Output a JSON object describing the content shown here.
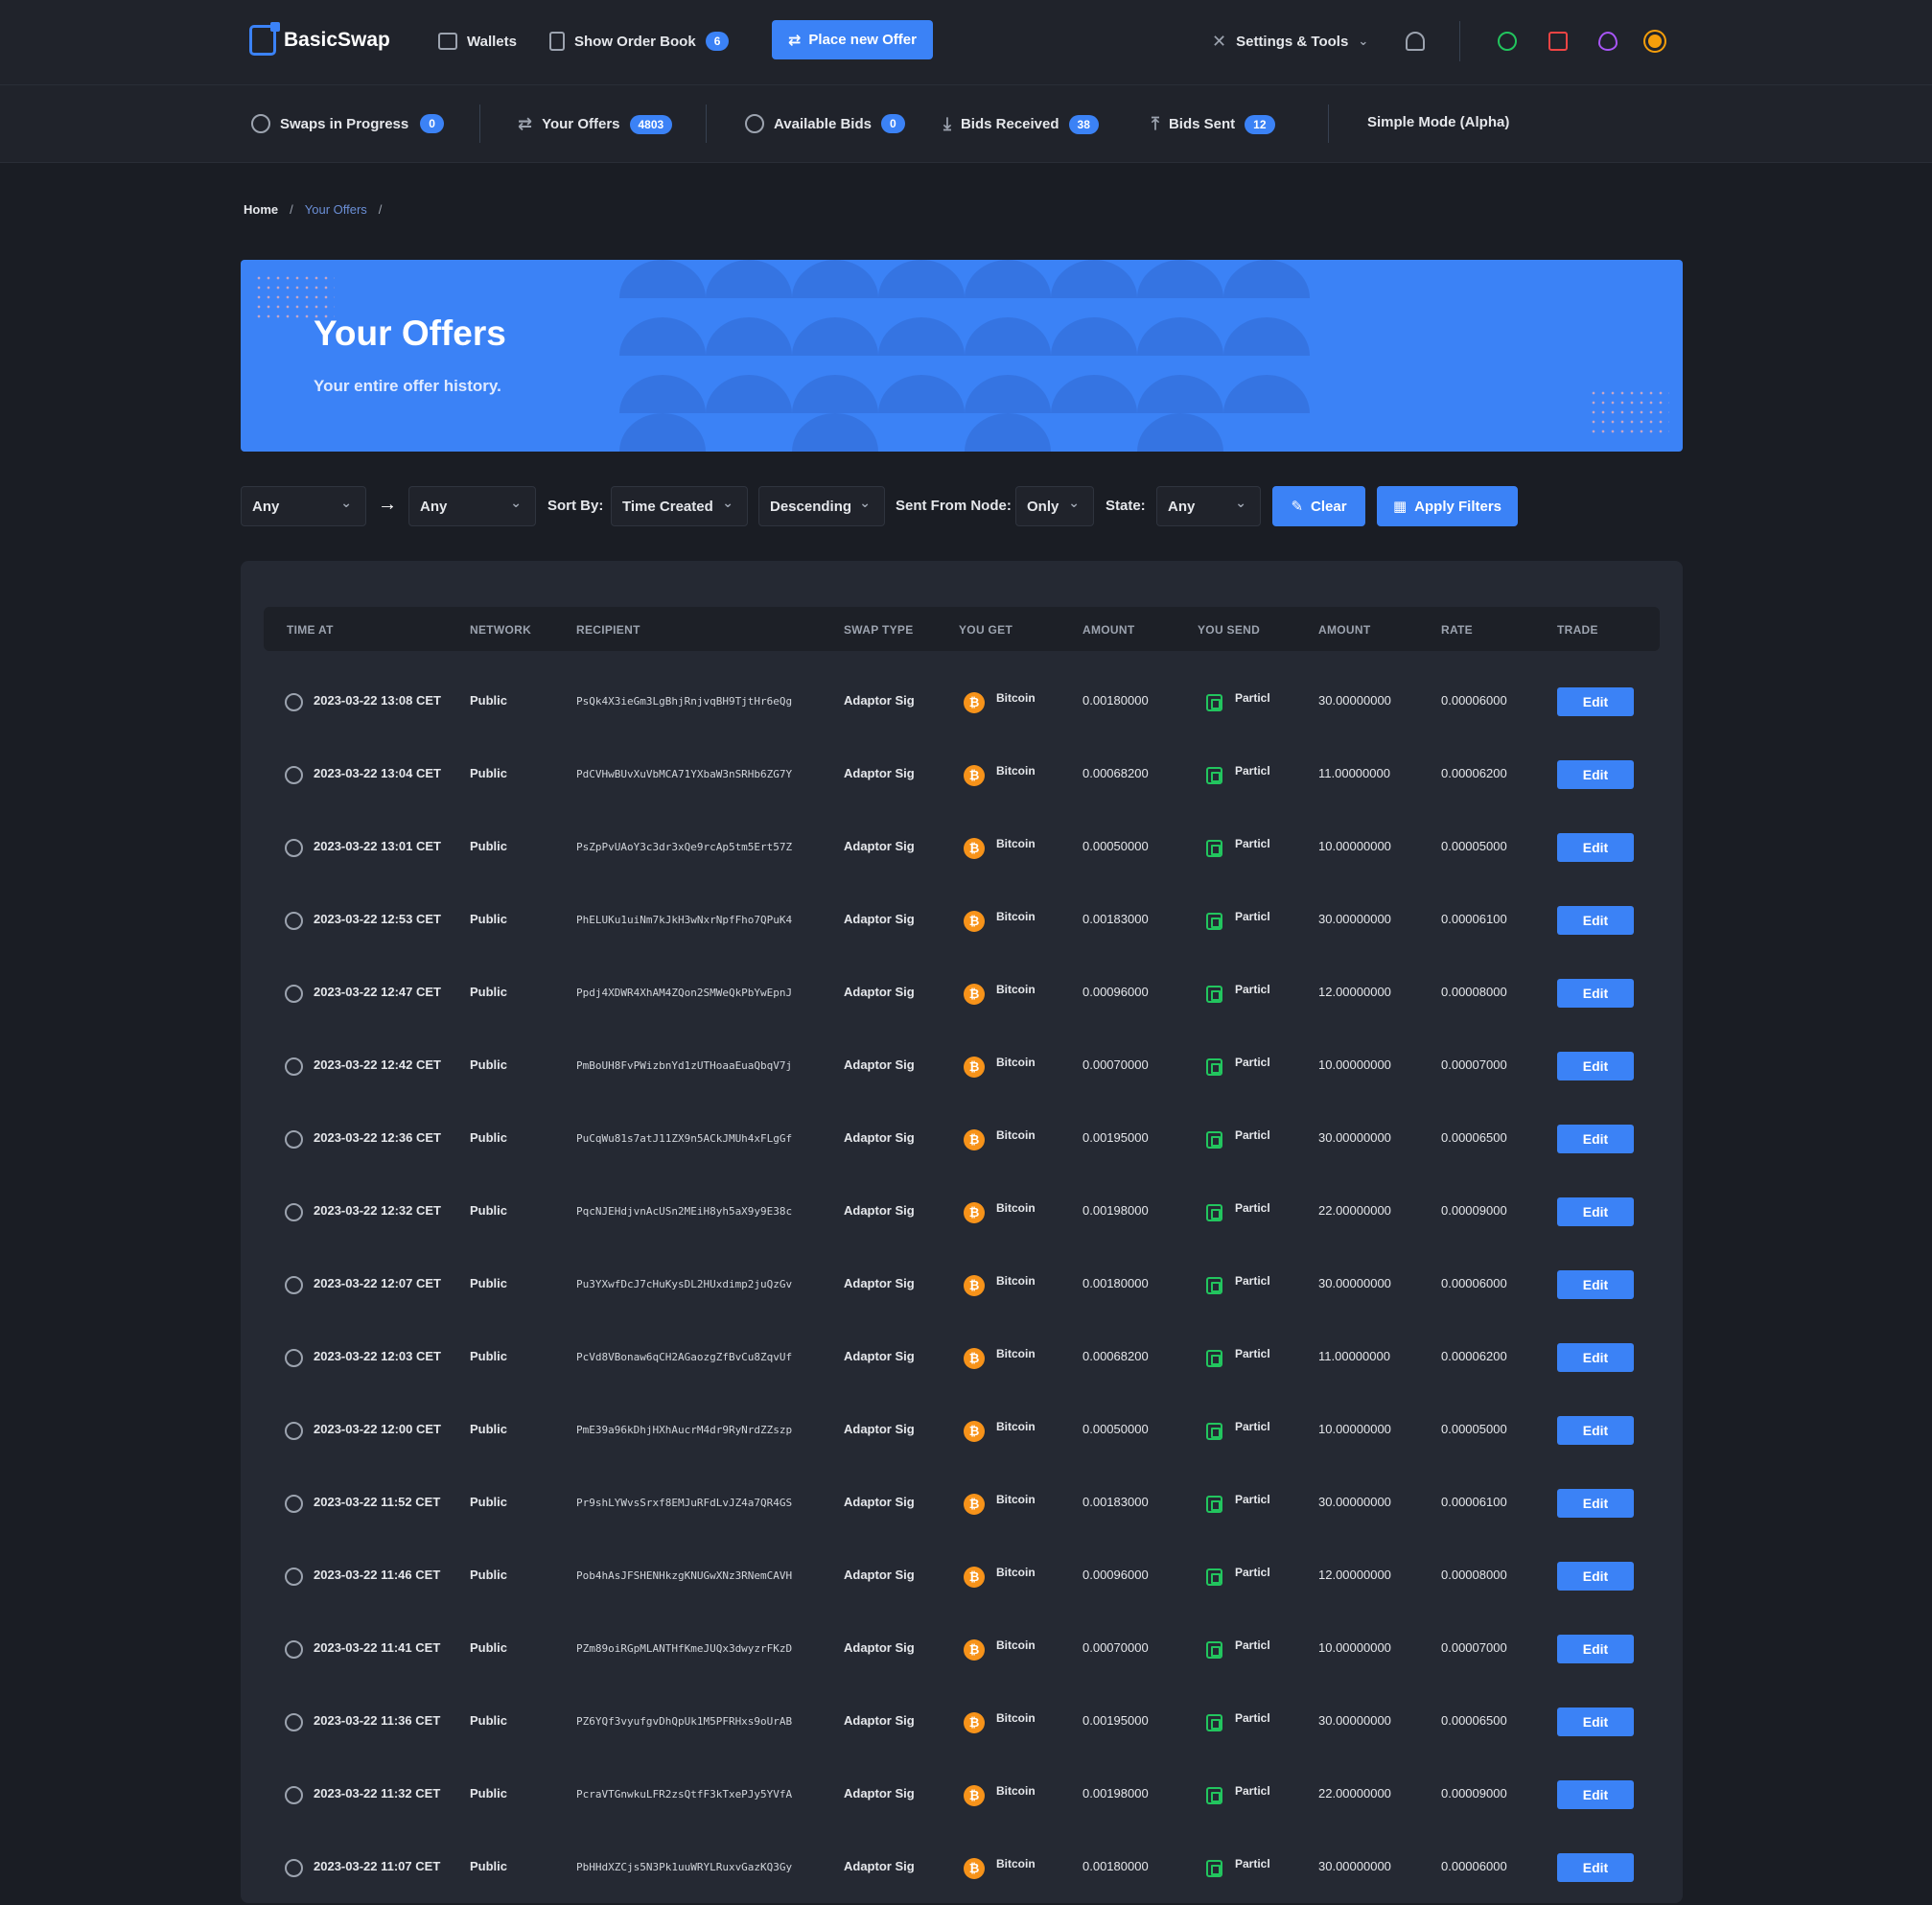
{
  "app": {
    "name": "BasicSwap"
  },
  "topnav": {
    "wallets": "Wallets",
    "order_book": "Show Order Book",
    "order_book_count": "6",
    "place_offer": "Place new Offer",
    "settings": "Settings & Tools"
  },
  "subnav": {
    "swaps": "Swaps in Progress",
    "swaps_count": "0",
    "offers": "Your Offers",
    "offers_count": "4803",
    "available_bids": "Available Bids",
    "available_bids_count": "0",
    "bids_received": "Bids Received",
    "bids_received_count": "38",
    "bids_sent": "Bids Sent",
    "bids_sent_count": "12",
    "simple_mode": "Simple Mode (Alpha)"
  },
  "breadcrumb": {
    "home": "Home",
    "current": "Your Offers",
    "sep": "/"
  },
  "hero": {
    "title": "Your Offers",
    "subtitle": "Your entire offer history."
  },
  "filters": {
    "coin_from": "Any",
    "coin_to": "Any",
    "sort_by_label": "Sort By:",
    "sort_by": "Time Created",
    "order": "Descending",
    "sent_from_label": "Sent From Node:",
    "sent_from": "Only",
    "state_label": "State:",
    "state": "Any",
    "clear": "Clear",
    "apply": "Apply Filters"
  },
  "table": {
    "headers": [
      "TIME AT",
      "NETWORK",
      "RECIPIENT",
      "SWAP TYPE",
      "YOU GET",
      "AMOUNT",
      "YOU SEND",
      "AMOUNT",
      "RATE",
      "TRADE"
    ],
    "edit_label": "Edit",
    "rows": [
      {
        "time": "2023-03-22 13:08 CET",
        "network": "Public",
        "recipient": "PsQk4X3ieGm3LgBhjRnjvqBH9TjtHr6eQg",
        "swap": "Adaptor Sig",
        "get": "Bitcoin",
        "get_amt": "0.00180000",
        "send": "Particl",
        "send_amt": "30.00000000",
        "rate": "0.00006000"
      },
      {
        "time": "2023-03-22 13:04 CET",
        "network": "Public",
        "recipient": "PdCVHwBUvXuVbMCA71YXbaW3nSRHb6ZG7Y",
        "swap": "Adaptor Sig",
        "get": "Bitcoin",
        "get_amt": "0.00068200",
        "send": "Particl",
        "send_amt": "11.00000000",
        "rate": "0.00006200"
      },
      {
        "time": "2023-03-22 13:01 CET",
        "network": "Public",
        "recipient": "PsZpPvUAoY3c3dr3xQe9rcAp5tm5Ert57Z",
        "swap": "Adaptor Sig",
        "get": "Bitcoin",
        "get_amt": "0.00050000",
        "send": "Particl",
        "send_amt": "10.00000000",
        "rate": "0.00005000"
      },
      {
        "time": "2023-03-22 12:53 CET",
        "network": "Public",
        "recipient": "PhELUKu1uiNm7kJkH3wNxrNpfFho7QPuK4",
        "swap": "Adaptor Sig",
        "get": "Bitcoin",
        "get_amt": "0.00183000",
        "send": "Particl",
        "send_amt": "30.00000000",
        "rate": "0.00006100"
      },
      {
        "time": "2023-03-22 12:47 CET",
        "network": "Public",
        "recipient": "Ppdj4XDWR4XhAM4ZQon2SMWeQkPbYwEpnJ",
        "swap": "Adaptor Sig",
        "get": "Bitcoin",
        "get_amt": "0.00096000",
        "send": "Particl",
        "send_amt": "12.00000000",
        "rate": "0.00008000"
      },
      {
        "time": "2023-03-22 12:42 CET",
        "network": "Public",
        "recipient": "PmBoUH8FvPWizbnYd1zUTHoaaEuaQbqV7j",
        "swap": "Adaptor Sig",
        "get": "Bitcoin",
        "get_amt": "0.00070000",
        "send": "Particl",
        "send_amt": "10.00000000",
        "rate": "0.00007000"
      },
      {
        "time": "2023-03-22 12:36 CET",
        "network": "Public",
        "recipient": "PuCqWu81s7atJ11ZX9n5ACkJMUh4xFLgGf",
        "swap": "Adaptor Sig",
        "get": "Bitcoin",
        "get_amt": "0.00195000",
        "send": "Particl",
        "send_amt": "30.00000000",
        "rate": "0.00006500"
      },
      {
        "time": "2023-03-22 12:32 CET",
        "network": "Public",
        "recipient": "PqcNJEHdjvnAcUSn2MEiH8yh5aX9y9E38c",
        "swap": "Adaptor Sig",
        "get": "Bitcoin",
        "get_amt": "0.00198000",
        "send": "Particl",
        "send_amt": "22.00000000",
        "rate": "0.00009000"
      },
      {
        "time": "2023-03-22 12:07 CET",
        "network": "Public",
        "recipient": "Pu3YXwfDcJ7cHuKysDL2HUxdimp2juQzGv",
        "swap": "Adaptor Sig",
        "get": "Bitcoin",
        "get_amt": "0.00180000",
        "send": "Particl",
        "send_amt": "30.00000000",
        "rate": "0.00006000"
      },
      {
        "time": "2023-03-22 12:03 CET",
        "network": "Public",
        "recipient": "PcVd8VBonaw6qCH2AGaozgZfBvCu8ZqvUf",
        "swap": "Adaptor Sig",
        "get": "Bitcoin",
        "get_amt": "0.00068200",
        "send": "Particl",
        "send_amt": "11.00000000",
        "rate": "0.00006200"
      },
      {
        "time": "2023-03-22 12:00 CET",
        "network": "Public",
        "recipient": "PmE39a96kDhjHXhAucrM4dr9RyNrdZZszp",
        "swap": "Adaptor Sig",
        "get": "Bitcoin",
        "get_amt": "0.00050000",
        "send": "Particl",
        "send_amt": "10.00000000",
        "rate": "0.00005000"
      },
      {
        "time": "2023-03-22 11:52 CET",
        "network": "Public",
        "recipient": "Pr9shLYWvsSrxf8EMJuRFdLvJZ4a7QR4GS",
        "swap": "Adaptor Sig",
        "get": "Bitcoin",
        "get_amt": "0.00183000",
        "send": "Particl",
        "send_amt": "30.00000000",
        "rate": "0.00006100"
      },
      {
        "time": "2023-03-22 11:46 CET",
        "network": "Public",
        "recipient": "Pob4hAsJFSHENHkzgKNUGwXNz3RNemCAVH",
        "swap": "Adaptor Sig",
        "get": "Bitcoin",
        "get_amt": "0.00096000",
        "send": "Particl",
        "send_amt": "12.00000000",
        "rate": "0.00008000"
      },
      {
        "time": "2023-03-22 11:41 CET",
        "network": "Public",
        "recipient": "PZm89oiRGpMLANTHfKmeJUQx3dwyzrFKzD",
        "swap": "Adaptor Sig",
        "get": "Bitcoin",
        "get_amt": "0.00070000",
        "send": "Particl",
        "send_amt": "10.00000000",
        "rate": "0.00007000"
      },
      {
        "time": "2023-03-22 11:36 CET",
        "network": "Public",
        "recipient": "PZ6YQf3vyufgvDhQpUk1M5PFRHxs9oUrAB",
        "swap": "Adaptor Sig",
        "get": "Bitcoin",
        "get_amt": "0.00195000",
        "send": "Particl",
        "send_amt": "30.00000000",
        "rate": "0.00006500"
      },
      {
        "time": "2023-03-22 11:32 CET",
        "network": "Public",
        "recipient": "PcraVTGnwkuLFR2zsQtfF3kTxePJy5YVfA",
        "swap": "Adaptor Sig",
        "get": "Bitcoin",
        "get_amt": "0.00198000",
        "send": "Particl",
        "send_amt": "22.00000000",
        "rate": "0.00009000"
      },
      {
        "time": "2023-03-22 11:07 CET",
        "network": "Public",
        "recipient": "PbHHdXZCjs5N3Pk1uuWRYLRuxvGazKQ3Gy",
        "swap": "Adaptor Sig",
        "get": "Bitcoin",
        "get_amt": "0.00180000",
        "send": "Particl",
        "send_amt": "30.00000000",
        "rate": "0.00006000"
      }
    ]
  }
}
